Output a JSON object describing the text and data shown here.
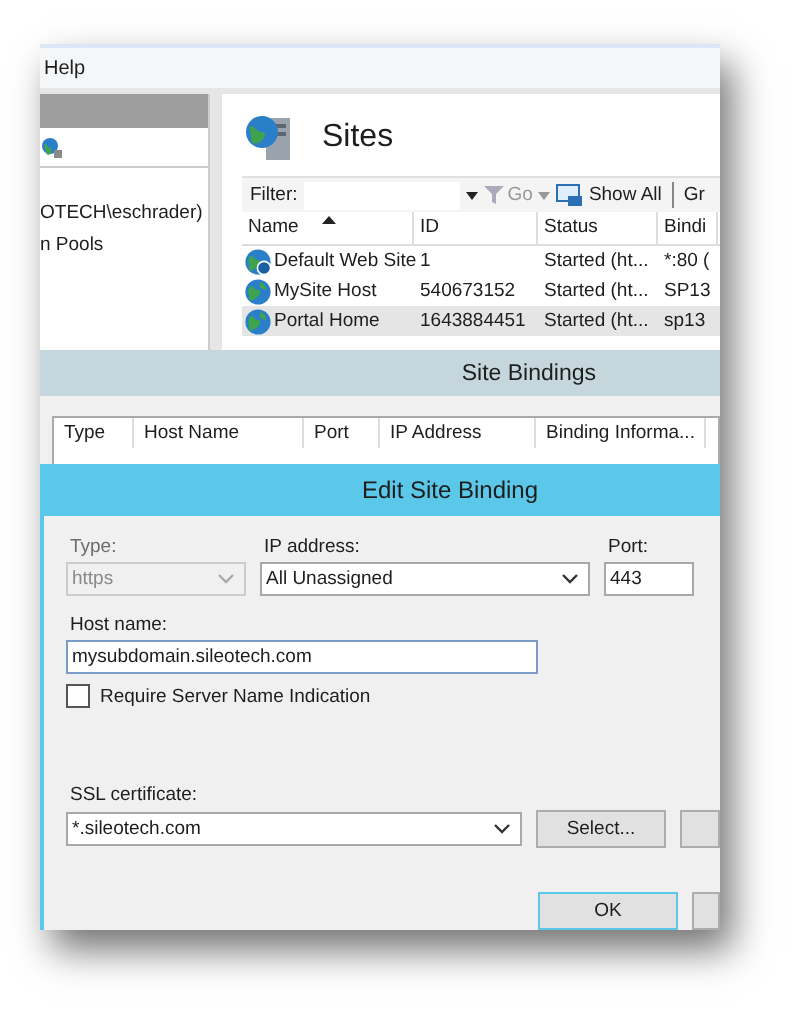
{
  "menu": {
    "items": [
      "Help"
    ]
  },
  "connections": {
    "items": [
      {
        "label": "OTECH\\eschrader)"
      },
      {
        "label": "n Pools"
      }
    ]
  },
  "sites": {
    "title": "Sites",
    "toolbar": {
      "filter_label": "Filter:",
      "go": "Go",
      "show_all": "Show All",
      "group": "Gr"
    },
    "table": {
      "columns": [
        "Name",
        "ID",
        "Status",
        "Bindi"
      ],
      "rows": [
        {
          "kind": "default",
          "name": "Default Web Site",
          "id": "1",
          "status": "Started (ht...",
          "binding": "*:80 (",
          "selected": false
        },
        {
          "kind": "site",
          "name": "MySite Host",
          "id": "540673152",
          "status": "Started (ht...",
          "binding": "SP13",
          "selected": false
        },
        {
          "kind": "site",
          "name": "Portal Home",
          "id": "1643884451",
          "status": "Started (ht...",
          "binding": "sp13",
          "selected": true
        }
      ]
    }
  },
  "site_bindings": {
    "title": "Site Bindings",
    "columns": [
      "Type",
      "Host Name",
      "Port",
      "IP Address",
      "Binding Informa..."
    ]
  },
  "edit_binding": {
    "title": "Edit Site Binding",
    "type": {
      "label": "Type:",
      "value": "https",
      "disabled": true
    },
    "ip_address": {
      "label": "IP address:",
      "value": "All Unassigned"
    },
    "port": {
      "label": "Port:",
      "value": "443"
    },
    "host_name": {
      "label": "Host name:",
      "value": "mysubdomain.sileotech.com"
    },
    "sni": {
      "label": "Require Server Name Indication",
      "checked": false
    },
    "ssl_certificate": {
      "label": "SSL certificate:",
      "value": "*.sileotech.com",
      "button": "Select..."
    },
    "ok_button": "OK"
  }
}
